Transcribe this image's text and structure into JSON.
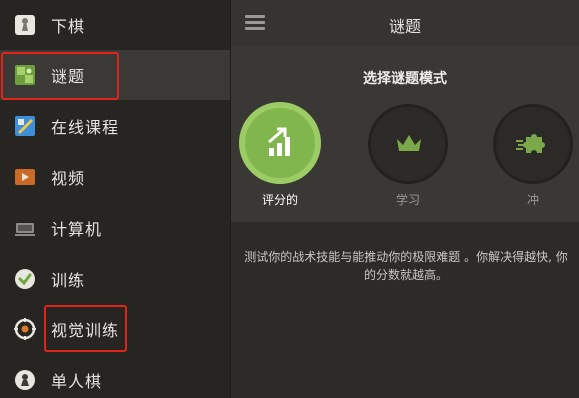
{
  "sidebar": {
    "items": [
      {
        "label": "下棋",
        "icon": "pawn-icon"
      },
      {
        "label": "谜题",
        "icon": "puzzle-icon"
      },
      {
        "label": "在线课程",
        "icon": "lesson-icon"
      },
      {
        "label": "视频",
        "icon": "video-icon"
      },
      {
        "label": "计算机",
        "icon": "computer-icon"
      },
      {
        "label": "训练",
        "icon": "check-icon"
      },
      {
        "label": "视觉训练",
        "icon": "target-icon"
      },
      {
        "label": "单人棋",
        "icon": "solo-chess-icon"
      }
    ]
  },
  "header": {
    "title": "谜题"
  },
  "mode_select": {
    "title": "选择谜题模式",
    "modes": [
      {
        "label": "评分的",
        "icon": "rated-chart-icon",
        "selected": true
      },
      {
        "label": "学习",
        "icon": "crown-icon",
        "selected": false
      },
      {
        "label": "冲",
        "icon": "rush-puzzle-icon",
        "selected": false
      }
    ]
  },
  "description": "测试你的战术技能与能推动你的极限难题 。你解决得越快, 你的分数就越高。",
  "colors": {
    "accent": "#81b64c",
    "highlight": "#e0231c"
  }
}
